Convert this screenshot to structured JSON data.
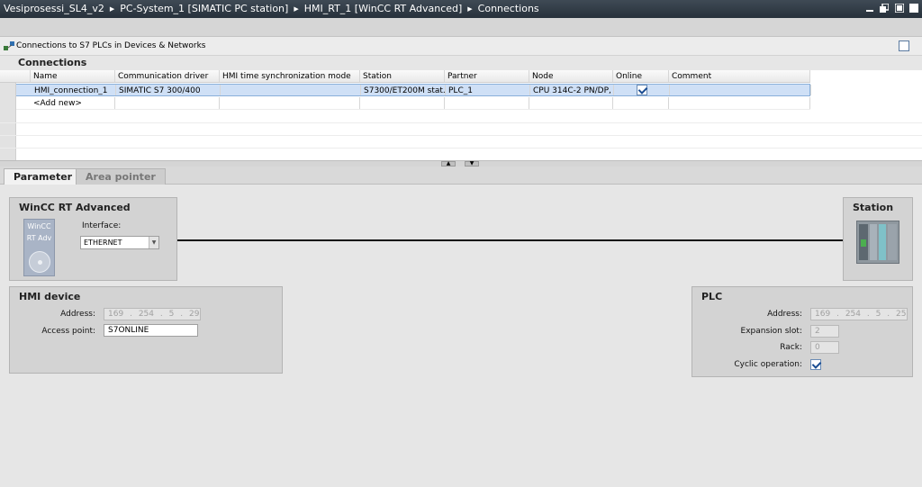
{
  "breadcrumb": [
    "Vesiprosessi_SL4_v2",
    "PC-System_1 [SIMATIC PC station]",
    "HMI_RT_1 [WinCC RT Advanced]",
    "Connections"
  ],
  "header": {
    "title": "Connections to S7 PLCs in Devices & Networks"
  },
  "section_title": "Connections",
  "table": {
    "columns": [
      "Name",
      "Communication driver",
      "HMI time synchronization mode",
      "Station",
      "Partner",
      "Node",
      "Online",
      "Comment"
    ],
    "rows": [
      {
        "name": "HMI_connection_1",
        "driver": "SIMATIC S7 300/400",
        "sync": "",
        "station": "S7300/ET200M stat...",
        "partner": "PLC_1",
        "node": "CPU 314C-2 PN/DP, ...",
        "online": true,
        "comment": ""
      }
    ],
    "add_new": "<Add new>"
  },
  "tabs": [
    "Parameter",
    "Area pointer"
  ],
  "left_device": {
    "title": "WinCC RT Advanced",
    "icon_label_1": "WinCC",
    "icon_label_2": "RT Adv",
    "interface_label": "Interface:",
    "interface_value": "ETHERNET"
  },
  "right_device": {
    "title": "Station"
  },
  "hmi": {
    "title": "HMI device",
    "address_label": "Address:",
    "address": [
      "169",
      "254",
      "5",
      "29"
    ],
    "access_point_label": "Access point:",
    "access_point": "S7ONLINE"
  },
  "plc": {
    "title": "PLC",
    "address_label": "Address:",
    "address": [
      "169",
      "254",
      "5",
      "25"
    ],
    "expansion_label": "Expansion slot:",
    "expansion": "2",
    "rack_label": "Rack:",
    "rack": "0",
    "cyclic_label": "Cyclic operation:",
    "cyclic": true
  }
}
